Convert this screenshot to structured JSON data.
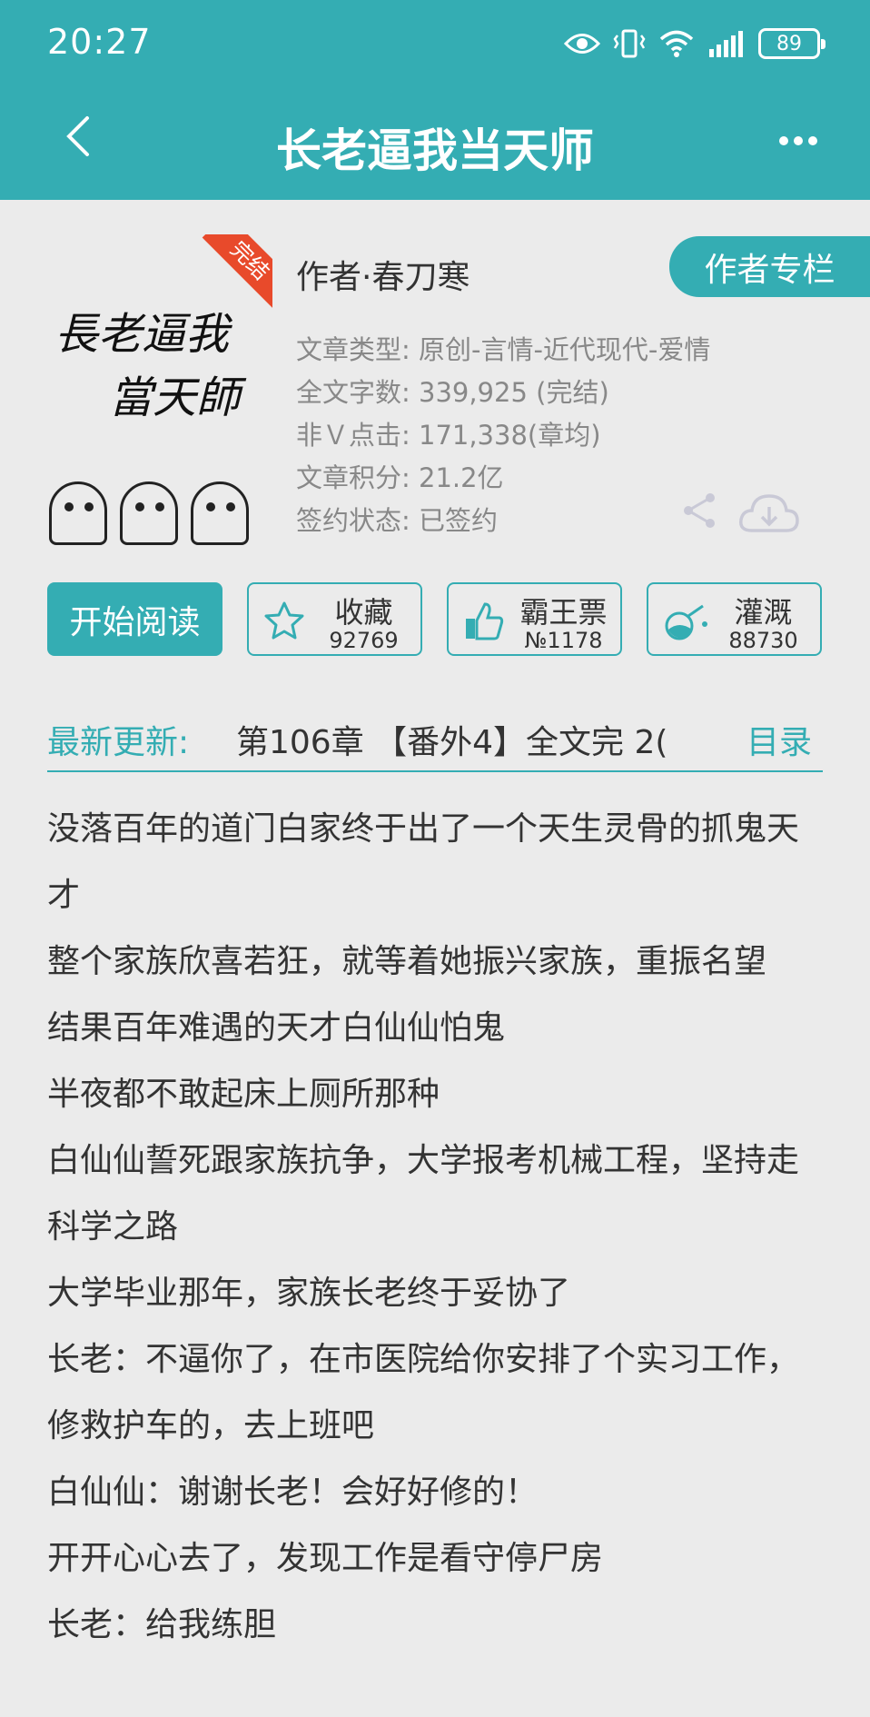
{
  "status": {
    "time": "20:27",
    "battery": "89"
  },
  "header": {
    "title": "长老逼我当天师"
  },
  "cover": {
    "line1": "長老逼我",
    "line2": "當天師",
    "ribbon": "完结"
  },
  "book": {
    "author": "作者·春刀寒",
    "author_column": "作者专栏",
    "meta": [
      "文章类型: 原创-言情-近代现代-爱情",
      "全文字数: 339,925 (完结)",
      "非Ｖ点击: 171,338(章均)",
      "文章积分: 21.2亿",
      "签约状态: 已签约"
    ]
  },
  "actions": {
    "read": "开始阅读",
    "collect": {
      "label": "收藏",
      "count": "92769"
    },
    "vote": {
      "label": "霸王票",
      "count": "№1178"
    },
    "irrigate": {
      "label": "灌溉",
      "count": "88730"
    }
  },
  "latest": {
    "label": "最新更新:",
    "value": "第106章 【番外4】全文完 2(",
    "toc": "目录"
  },
  "intro": [
    "没落百年的道门白家终于出了一个天生灵骨的抓鬼天才",
    "整个家族欣喜若狂，就等着她振兴家族，重振名望",
    "结果百年难遇的天才白仙仙怕鬼",
    "半夜都不敢起床上厕所那种",
    "白仙仙誓死跟家族抗争，大学报考机械工程，坚持走科学之路",
    "大学毕业那年，家族长老终于妥协了",
    "长老：不逼你了，在市医院给你安排了个实习工作，修救护车的，去上班吧",
    "白仙仙：谢谢长老！会好好修的！",
    "开开心心去了，发现工作是看守停尸房",
    "长老：给我练胆"
  ]
}
